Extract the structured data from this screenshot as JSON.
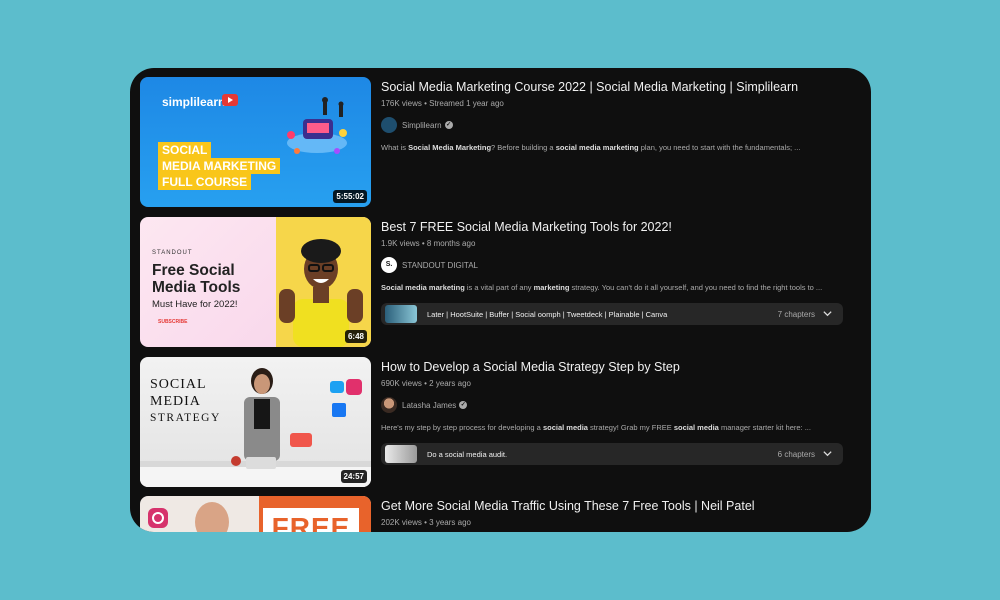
{
  "videos": [
    {
      "title": "Social Media Marketing Course 2022 | Social Media Marketing | Simplilearn",
      "meta": "176K views • Streamed 1 year ago",
      "channel": "Simplilearn",
      "description_pre": "What is ",
      "description_b1": "Social Media Marketing",
      "description_mid": "? Before building a ",
      "description_b2": "social media marketing",
      "description_post": " plan, you need to start with the fundamentals; ...",
      "duration": "5:55:02",
      "thumb": {
        "brand": "simplilearn",
        "line1": "SOCIAL",
        "line2": "MEDIA MARKETING",
        "line3": "FULL COURSE"
      }
    },
    {
      "title": "Best 7 FREE Social Media Marketing Tools for 2022!",
      "meta": "1.9K views • 8 months ago",
      "channel": "STANDOUT DIGITAL",
      "channel_initial": "S.",
      "description_b1": "Social media marketing",
      "description_mid": " is a vital part of any ",
      "description_b2": "marketing",
      "description_post": " strategy. You can't do it all yourself, and you need to find the right tools to ...",
      "duration": "6:48",
      "chapters_text": "Later | HootSuite | Buffer | Social oomph | Tweetdeck | Plainable | Canva",
      "chapters_count": "7 chapters",
      "thumb": {
        "label": "STANDOUT",
        "line1": "Free Social",
        "line2": "Media Tools",
        "line3": "Must Have for 2022!",
        "line4": "SUBSCRIBE"
      }
    },
    {
      "title": "How to Develop a Social Media Strategy Step by Step",
      "meta": "690K views • 2 years ago",
      "channel": "Latasha James",
      "description_pre": "Here's my step by step process for developing a ",
      "description_b1": "social media",
      "description_mid": " strategy! Grab my FREE ",
      "description_b2": "social media",
      "description_post": " manager starter kit here: ...",
      "duration": "24:57",
      "chapters_text": "Do a social media audit.",
      "chapters_count": "6 chapters",
      "thumb": {
        "line1": "SOCIAL",
        "line2": "MEDIA",
        "line3": "STRATEGY"
      }
    },
    {
      "title": "Get More Social Media Traffic Using These 7 Free Tools | Neil Patel",
      "meta": "202K views • 3 years ago",
      "thumb": {
        "word": "FREE"
      }
    }
  ],
  "colors": {
    "background": "#5cbdcc",
    "screen": "#0f0f0f",
    "chip": "#272727"
  }
}
